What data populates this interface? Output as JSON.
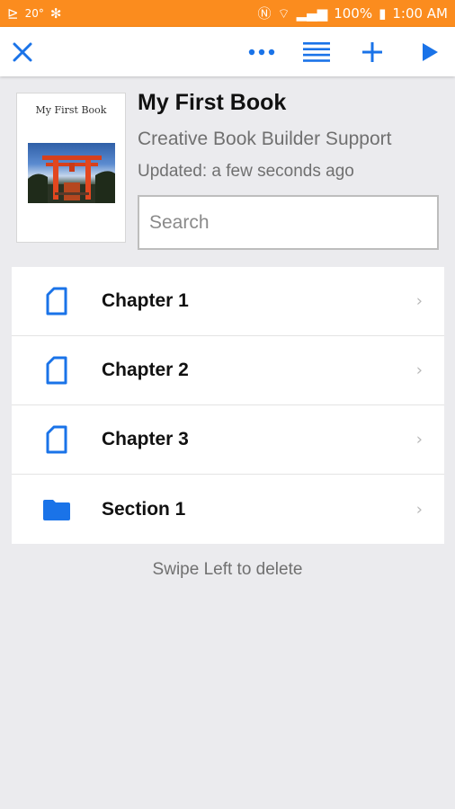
{
  "status_bar": {
    "temperature": "20°",
    "battery": "100%",
    "time": "1:00 AM",
    "background_color": "#fb8c1e"
  },
  "toolbar": {
    "accent_color": "#1a73e8",
    "icons": [
      "close-icon",
      "more-icon",
      "list-icon",
      "add-icon",
      "play-icon"
    ]
  },
  "book": {
    "cover_title": "My First Book",
    "title": "My First Book",
    "author": "Creative Book Builder Support",
    "updated": "Updated: a few seconds ago"
  },
  "search": {
    "placeholder": "Search",
    "value": ""
  },
  "items": [
    {
      "label": "Chapter 1",
      "icon": "page-icon"
    },
    {
      "label": "Chapter 2",
      "icon": "page-icon"
    },
    {
      "label": "Chapter 3",
      "icon": "page-icon"
    },
    {
      "label": "Section 1",
      "icon": "folder-icon"
    }
  ],
  "hint": "Swipe Left to delete"
}
